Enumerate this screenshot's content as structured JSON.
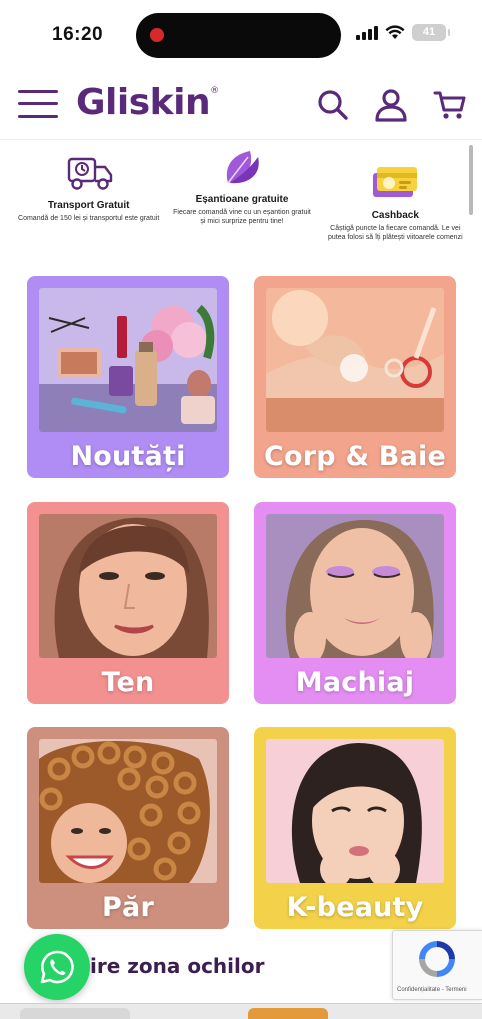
{
  "status_bar": {
    "time": "16:20",
    "battery": "41"
  },
  "header": {
    "logo": "Gliskin",
    "logo_mark": "®"
  },
  "benefits": [
    {
      "icon": "truck-icon",
      "title": "Transport Gratuit",
      "desc": "Comandă de 150 lei și transportul este gratuit"
    },
    {
      "icon": "leaf-icon",
      "title": "Eșantioane gratuite",
      "desc": "Fiecare comandă vine cu un eșantion gratuit și mici surprize pentru tine!"
    },
    {
      "icon": "cashback-card-icon",
      "title": "Cashback",
      "desc": "Câștigă puncte la fiecare comandă. Le vei putea folosi să îți plătești viitoarele comenzi"
    }
  ],
  "categories": [
    {
      "label": "Noutăți",
      "color": "#b08cf5"
    },
    {
      "label": "Corp & Baie",
      "color": "#f3a48c"
    },
    {
      "label": "Ten",
      "color": "#f39090"
    },
    {
      "label": "Machiaj",
      "color": "#e48ef4"
    },
    {
      "label": "Păr",
      "color": "#cd8f7e"
    },
    {
      "label": "K-beauty",
      "color": "#f3d24a"
    }
  ],
  "section_title": "ire zona ochilor",
  "recaptcha": {
    "text": "Confidențialitate - Termeni"
  },
  "colors": {
    "brand": "#5a2a7a",
    "whatsapp": "#25d366"
  }
}
